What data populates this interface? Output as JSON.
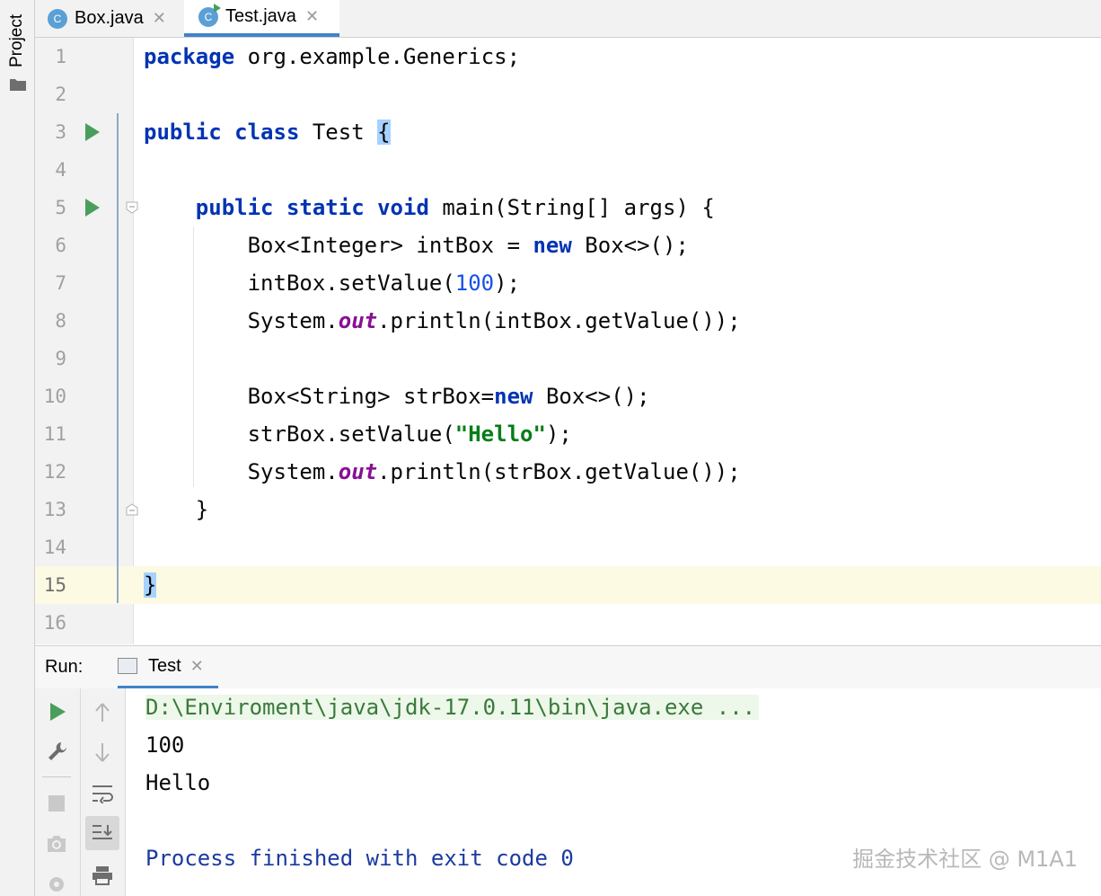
{
  "sidebar": {
    "project_label": "Project",
    "icon": "folder-icon"
  },
  "tabs": [
    {
      "label": "Box.java",
      "icon_letter": "C",
      "active": false
    },
    {
      "label": "Test.java",
      "icon_letter": "C",
      "active": true
    }
  ],
  "editor": {
    "line_numbers": [
      "1",
      "2",
      "3",
      "4",
      "5",
      "6",
      "7",
      "8",
      "9",
      "10",
      "11",
      "12",
      "13",
      "14",
      "15",
      "16"
    ],
    "lines": [
      [
        {
          "t": "package",
          "c": "kw"
        },
        {
          "t": " org.example.Generics;",
          "c": ""
        }
      ],
      [],
      [
        {
          "t": "public",
          "c": "kw"
        },
        {
          "t": " ",
          "c": ""
        },
        {
          "t": "class",
          "c": "kw"
        },
        {
          "t": " Test ",
          "c": ""
        },
        {
          "t": "{",
          "c": "brace-hl"
        }
      ],
      [],
      [
        {
          "t": "    ",
          "c": ""
        },
        {
          "t": "public",
          "c": "kw"
        },
        {
          "t": " ",
          "c": ""
        },
        {
          "t": "static",
          "c": "kw"
        },
        {
          "t": " ",
          "c": ""
        },
        {
          "t": "void",
          "c": "kw"
        },
        {
          "t": " main(String[] args) {",
          "c": ""
        }
      ],
      [
        {
          "t": "        Box<Integer> intBox = ",
          "c": ""
        },
        {
          "t": "new",
          "c": "kw"
        },
        {
          "t": " Box<>();",
          "c": ""
        }
      ],
      [
        {
          "t": "        intBox.setValue(",
          "c": ""
        },
        {
          "t": "100",
          "c": "num"
        },
        {
          "t": ");",
          "c": ""
        }
      ],
      [
        {
          "t": "        System.",
          "c": ""
        },
        {
          "t": "out",
          "c": "fld"
        },
        {
          "t": ".println(intBox.getValue());",
          "c": ""
        }
      ],
      [],
      [
        {
          "t": "        Box<String> strBox=",
          "c": ""
        },
        {
          "t": "new",
          "c": "kw"
        },
        {
          "t": " Box<>();",
          "c": ""
        }
      ],
      [
        {
          "t": "        strBox.setValue(",
          "c": ""
        },
        {
          "t": "\"Hello\"",
          "c": "str"
        },
        {
          "t": ");",
          "c": ""
        }
      ],
      [
        {
          "t": "        System.",
          "c": ""
        },
        {
          "t": "out",
          "c": "fld"
        },
        {
          "t": ".println(strBox.getValue());",
          "c": ""
        }
      ],
      [
        {
          "t": "    }",
          "c": ""
        }
      ],
      [],
      [
        {
          "t": "}",
          "c": "brace-hl"
        }
      ],
      []
    ],
    "current_line": "15",
    "run_markers_lines": [
      "3",
      "5"
    ]
  },
  "run_panel": {
    "label": "Run:",
    "tab_label": "Test",
    "console": {
      "command": "D:\\Enviroment\\java\\jdk-17.0.11\\bin\\java.exe ...",
      "output": [
        "100",
        "Hello"
      ],
      "exit_message": "Process finished with exit code 0"
    }
  },
  "watermark": "掘金技术社区 @ M1A1",
  "colors": {
    "keyword": "#0033b3",
    "number": "#1750eb",
    "string": "#067d17",
    "field": "#871094",
    "accent": "#4083c9",
    "run_green": "#4a9e5c"
  }
}
